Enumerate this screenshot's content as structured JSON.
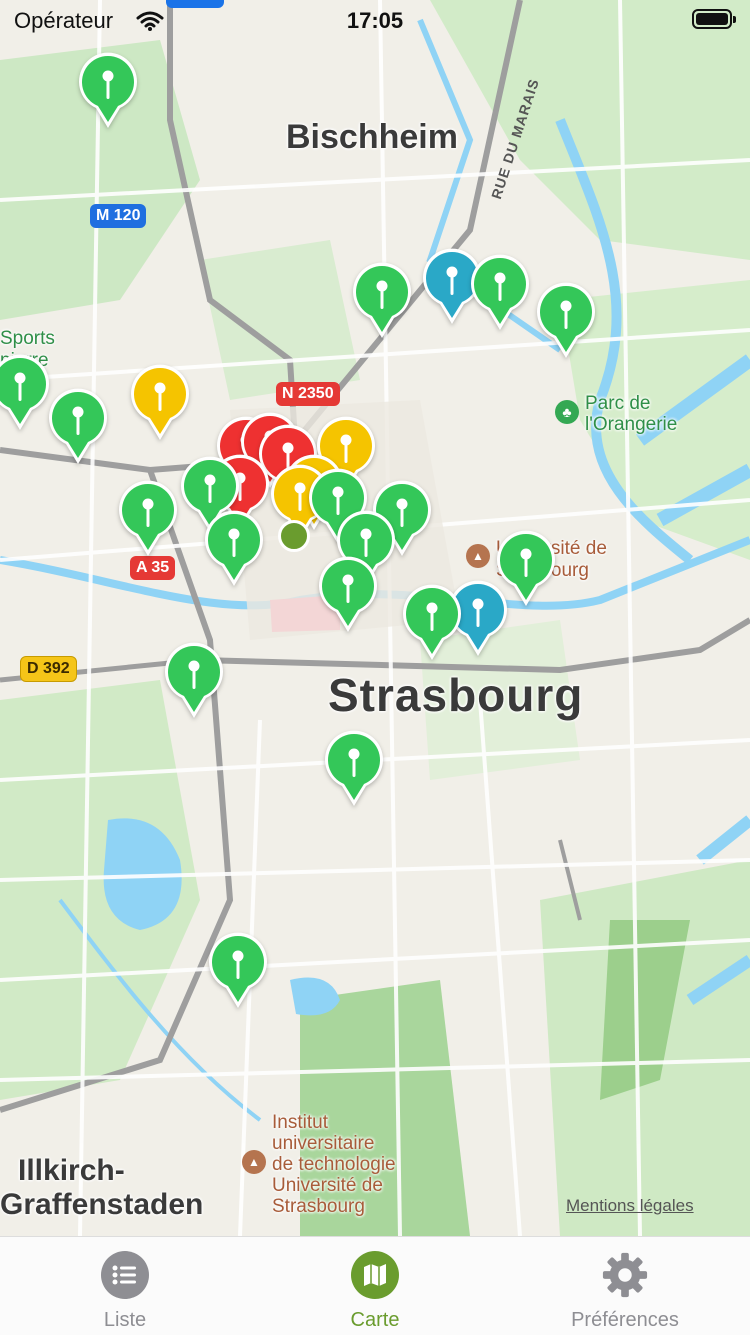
{
  "status_bar": {
    "carrier": "Opérateur",
    "time": "17:05"
  },
  "map": {
    "labels": {
      "bischheim": "Bischheim",
      "strasbourg": "Strasbourg",
      "illkirch": "Illkirch-",
      "graffenstaden": "Graffenstaden",
      "sports": "Sports",
      "sports_2": "pierre",
      "parc": "Parc de",
      "parc_2": "l'Orangerie",
      "universite": "Université de",
      "universite_2": "Strasbourg",
      "institut_1": "Institut",
      "institut_2": "universitaire",
      "institut_3": "de technologie",
      "institut_4": "Université de",
      "institut_5": "Strasbourg",
      "rue_du_marais": "RUE DU MARAIS"
    },
    "road_shields": {
      "m120": "M 120",
      "n2350": "N 2350",
      "a35": "A 35",
      "d392": "D 392"
    },
    "legal_link": "Mentions légales",
    "pin_colors": {
      "green": "#34c759",
      "teal": "#2aa8c7",
      "yellow": "#f5c400",
      "red": "#ee3131"
    }
  },
  "tab_bar": {
    "liste": "Liste",
    "carte": "Carte",
    "preferences": "Préférences",
    "active_color": "#6a9c2e",
    "inactive_color": "#8e8e93"
  }
}
